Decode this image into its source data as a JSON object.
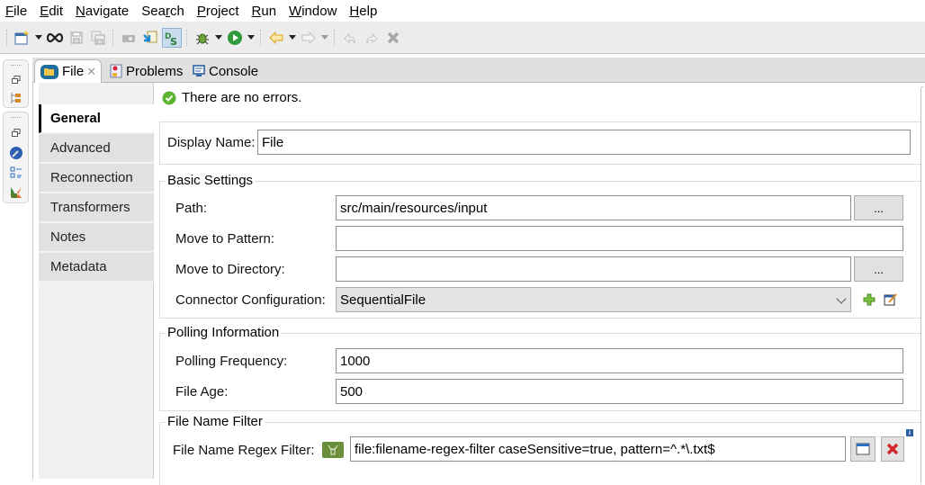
{
  "menu": {
    "items": [
      {
        "label": "File",
        "mnemonic": "F",
        "rest": "ile"
      },
      {
        "label": "Edit",
        "mnemonic": "E",
        "rest": "dit"
      },
      {
        "label": "Navigate",
        "mnemonic": "N",
        "rest": "avigate"
      },
      {
        "label": "Search",
        "pre": "Sea",
        "mnemonic": "r",
        "rest": "ch"
      },
      {
        "label": "Project",
        "mnemonic": "P",
        "rest": "roject"
      },
      {
        "label": "Run",
        "mnemonic": "R",
        "rest": "un"
      },
      {
        "label": "Window",
        "mnemonic": "W",
        "rest": "indow"
      },
      {
        "label": "Help",
        "mnemonic": "H",
        "rest": "elp"
      }
    ]
  },
  "toolbar": {
    "icons": [
      "new-wizard-icon",
      "link-icon",
      "save-icon",
      "save-all-icon",
      "camera-icon",
      "import-icon",
      "ds-perspective-icon",
      "debug-icon",
      "run-icon",
      "back-icon",
      "forward-icon",
      "undo-icon",
      "redo-icon",
      "delete-icon"
    ]
  },
  "tabs": [
    {
      "label": "File",
      "active": true,
      "closable": true
    },
    {
      "label": "Problems",
      "active": false
    },
    {
      "label": "Console",
      "active": false
    }
  ],
  "sidenav": {
    "items": [
      {
        "label": "General",
        "active": true
      },
      {
        "label": "Advanced"
      },
      {
        "label": "Reconnection"
      },
      {
        "label": "Transformers"
      },
      {
        "label": "Notes"
      },
      {
        "label": "Metadata"
      }
    ]
  },
  "status": {
    "message": "There are no errors."
  },
  "display_name": {
    "label": "Display Name:",
    "value": "File"
  },
  "basic_settings": {
    "title": "Basic Settings",
    "path": {
      "label": "Path:",
      "value": "src/main/resources/input",
      "browse": "..."
    },
    "move_to_pattern": {
      "label": "Move to Pattern:",
      "value": ""
    },
    "move_to_directory": {
      "label": "Move to Directory:",
      "value": "",
      "browse": "..."
    },
    "connector_configuration": {
      "label": "Connector Configuration:",
      "value": "SequentialFile"
    }
  },
  "polling": {
    "title": "Polling Information",
    "frequency": {
      "label": "Polling Frequency:",
      "value": "1000"
    },
    "file_age": {
      "label": "File Age:",
      "value": "500"
    }
  },
  "file_name_filter": {
    "title": "File Name Filter",
    "regex": {
      "label": "File Name Regex Filter:",
      "value": "file:filename-regex-filter caseSensitive=true, pattern=^.*\\.txt$"
    }
  },
  "colors": {
    "accent": "#1e5f99",
    "ok": "#5cb531",
    "delete": "#d02a2a",
    "filter_badge": "#6b8e3a"
  }
}
